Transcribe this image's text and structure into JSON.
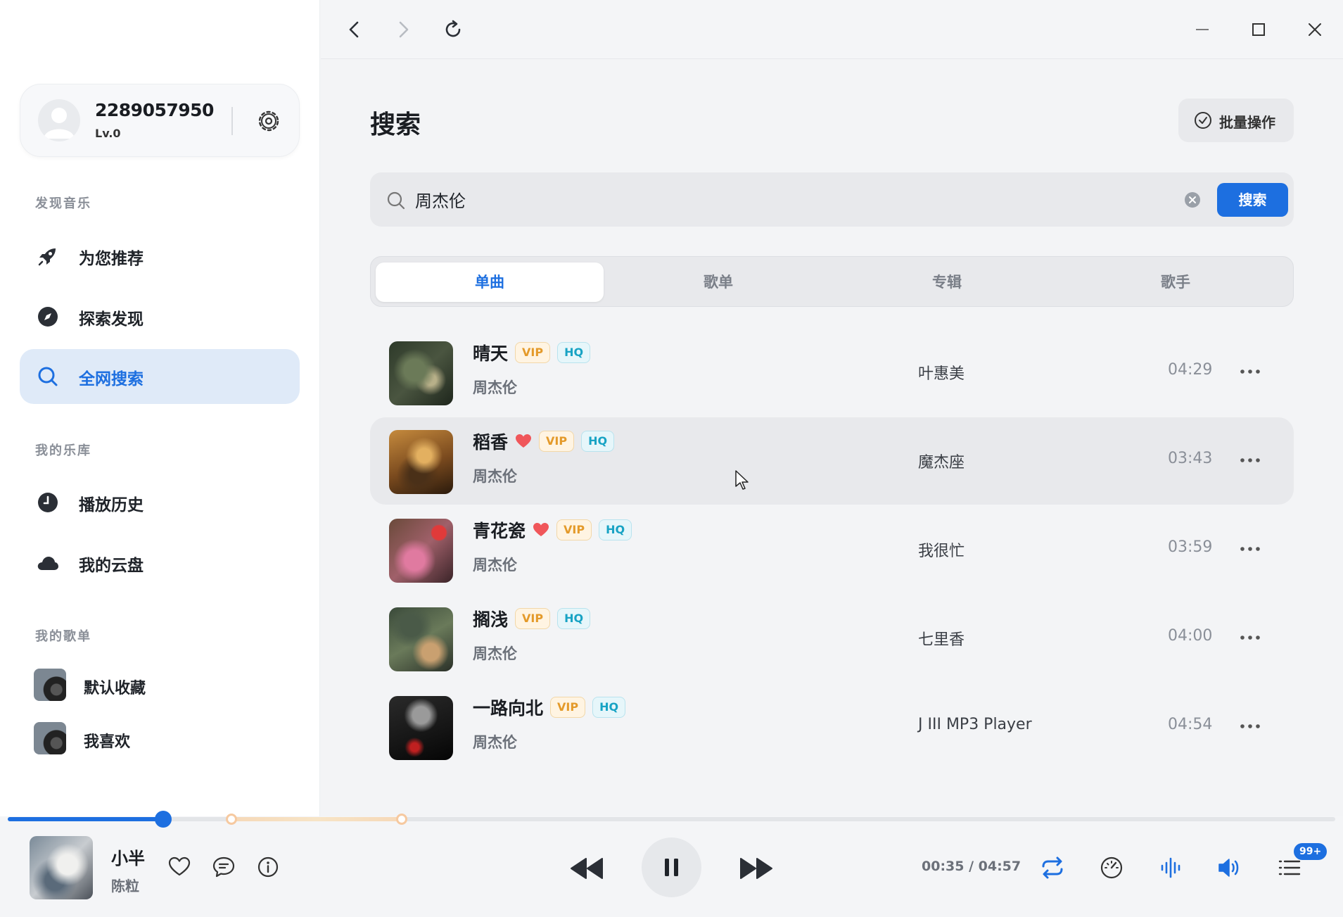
{
  "user": {
    "name": "2289057950",
    "level": "Lv.0"
  },
  "sidebar": {
    "sections": [
      "发现音乐",
      "我的乐库",
      "我的歌单"
    ],
    "discover": [
      {
        "label": "为您推荐",
        "icon": "rocket-icon"
      },
      {
        "label": "探索发现",
        "icon": "compass-icon"
      },
      {
        "label": "全网搜索",
        "icon": "search-icon",
        "active": true
      }
    ],
    "library": [
      {
        "label": "播放历史",
        "icon": "clock-icon"
      },
      {
        "label": "我的云盘",
        "icon": "cloud-icon"
      }
    ],
    "playlists": [
      {
        "label": "默认收藏"
      },
      {
        "label": "我喜欢"
      }
    ]
  },
  "main": {
    "title": "搜索",
    "batch_label": "批量操作",
    "search": {
      "value": "周杰伦",
      "button_label": "搜索"
    },
    "tabs": [
      {
        "label": "单曲",
        "active": true
      },
      {
        "label": "歌单"
      },
      {
        "label": "专辑"
      },
      {
        "label": "歌手"
      }
    ],
    "songs": [
      {
        "title": "晴天",
        "artist": "周杰伦",
        "album": "叶惠美",
        "duration": "04:29",
        "liked": false,
        "vip": "VIP",
        "hq": "HQ"
      },
      {
        "title": "稻香",
        "artist": "周杰伦",
        "album": "魔杰座",
        "duration": "03:43",
        "liked": true,
        "vip": "VIP",
        "hq": "HQ"
      },
      {
        "title": "青花瓷",
        "artist": "周杰伦",
        "album": "我很忙",
        "duration": "03:59",
        "liked": true,
        "vip": "VIP",
        "hq": "HQ"
      },
      {
        "title": "搁浅",
        "artist": "周杰伦",
        "album": "七里香",
        "duration": "04:00",
        "liked": false,
        "vip": "VIP",
        "hq": "HQ"
      },
      {
        "title": "一路向北",
        "artist": "周杰伦",
        "album": "J III MP3 Player",
        "duration": "04:54",
        "liked": false,
        "vip": "VIP",
        "hq": "HQ"
      }
    ]
  },
  "player": {
    "title": "小半",
    "artist": "陈粒",
    "time": "00:35 / 04:57",
    "progress": 0.1171,
    "queue_count": "99+"
  },
  "colors": {
    "accent": "#1d6fe0",
    "vip": "#e49a2a",
    "hq": "#18a3c4",
    "heart": "#f0565a"
  }
}
